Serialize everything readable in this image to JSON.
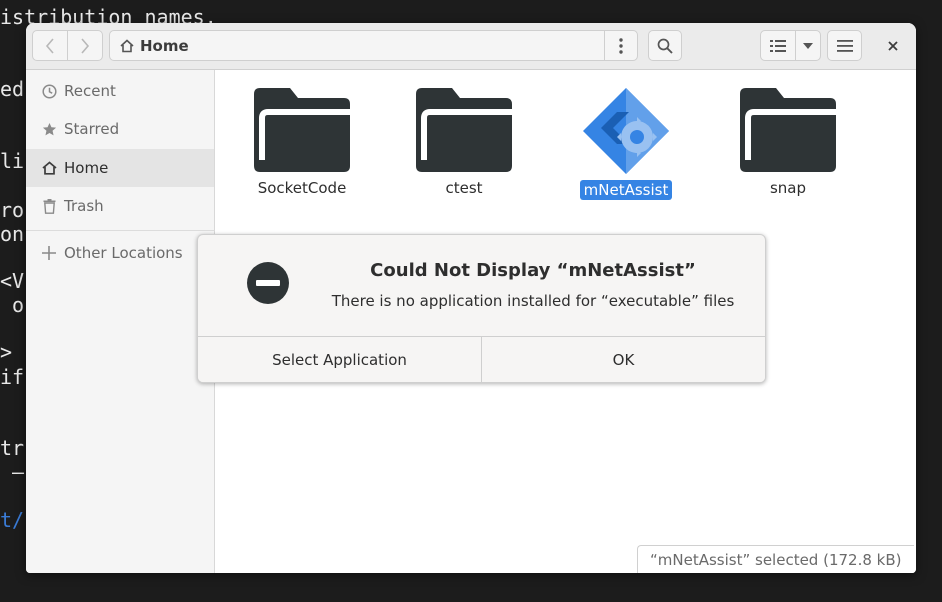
{
  "terminal": {
    "lines": [
      "istribution names.",
      "ed",
      "li",
      "ro",
      "on",
      "<V",
      " o",
      ">",
      "if",
      "tr",
      " –",
      "t/"
    ]
  },
  "headerbar": {
    "location": "Home"
  },
  "sidebar": {
    "items": [
      {
        "label": "Recent",
        "icon": "clock-icon"
      },
      {
        "label": "Starred",
        "icon": "star-icon"
      },
      {
        "label": "Home",
        "icon": "home-icon"
      },
      {
        "label": "Trash",
        "icon": "trash-icon"
      },
      {
        "label": "Other Locations",
        "icon": "plus-icon"
      }
    ]
  },
  "files": [
    {
      "name": "SocketCode",
      "type": "folder"
    },
    {
      "name": "ctest",
      "type": "folder"
    },
    {
      "name": "mNetAssist",
      "type": "executable",
      "selected": true
    },
    {
      "name": "snap",
      "type": "folder"
    }
  ],
  "status": "“mNetAssist” selected (172.8 kB)",
  "dialog": {
    "title": "Could Not Display “mNetAssist”",
    "message": "There is no application installed for “executable” files",
    "buttons": {
      "select": "Select Application",
      "ok": "OK"
    }
  },
  "colors": {
    "accent": "#3584e4",
    "folder": "#2e3436",
    "header": "#ebebeb"
  }
}
